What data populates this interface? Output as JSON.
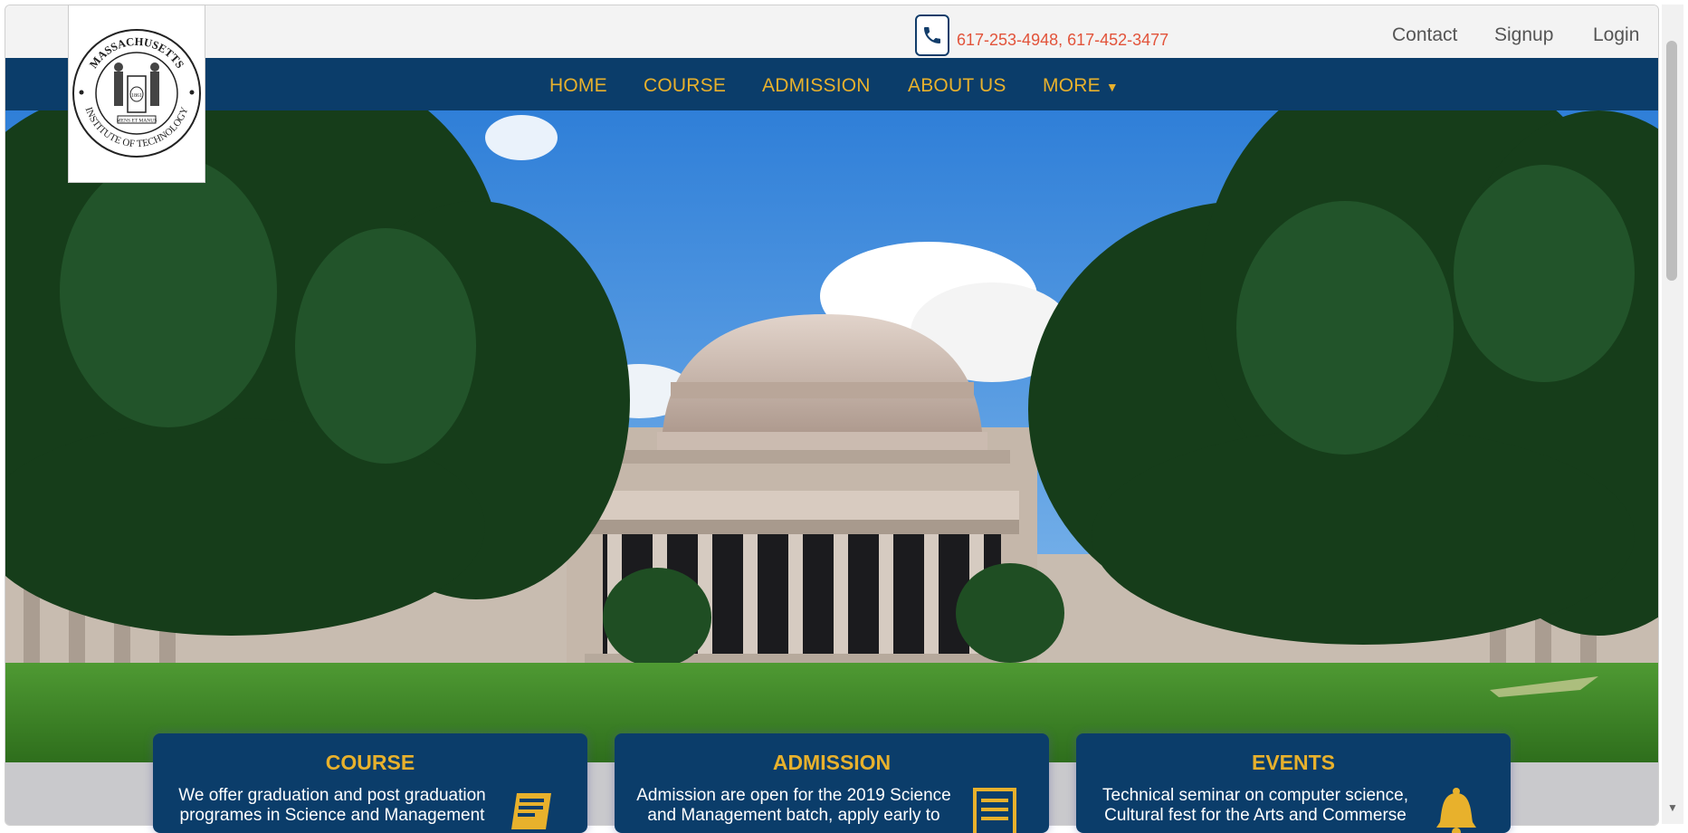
{
  "header": {
    "phone": "617-253-4948, 617-452-3477",
    "links": [
      "Contact",
      "Signup",
      "Login"
    ]
  },
  "logo": {
    "top_text": "MASSACHUSETTS",
    "bottom_text": "INSTITUTE OF TECHNOLOGY",
    "year": "1861",
    "motto": "MENS ET MANUS"
  },
  "nav": {
    "items": [
      "HOME",
      "COURSE",
      "ADMISSION",
      "ABOUT US",
      "MORE"
    ]
  },
  "cards": [
    {
      "title": "COURSE",
      "text": "We offer graduation and post graduation programes in Science and Management",
      "icon": "book-icon"
    },
    {
      "title": "ADMISSION",
      "text": "Admission are open for the 2019 Science and Management batch, apply early to",
      "icon": "form-icon"
    },
    {
      "title": "EVENTS",
      "text": "Technical seminar on computer science, Cultural fest for the Arts and Commerse",
      "icon": "bell-icon"
    }
  ],
  "colors": {
    "navy": "#0b3d6a",
    "gold": "#e8b12c",
    "phone_red": "#e2533a"
  }
}
